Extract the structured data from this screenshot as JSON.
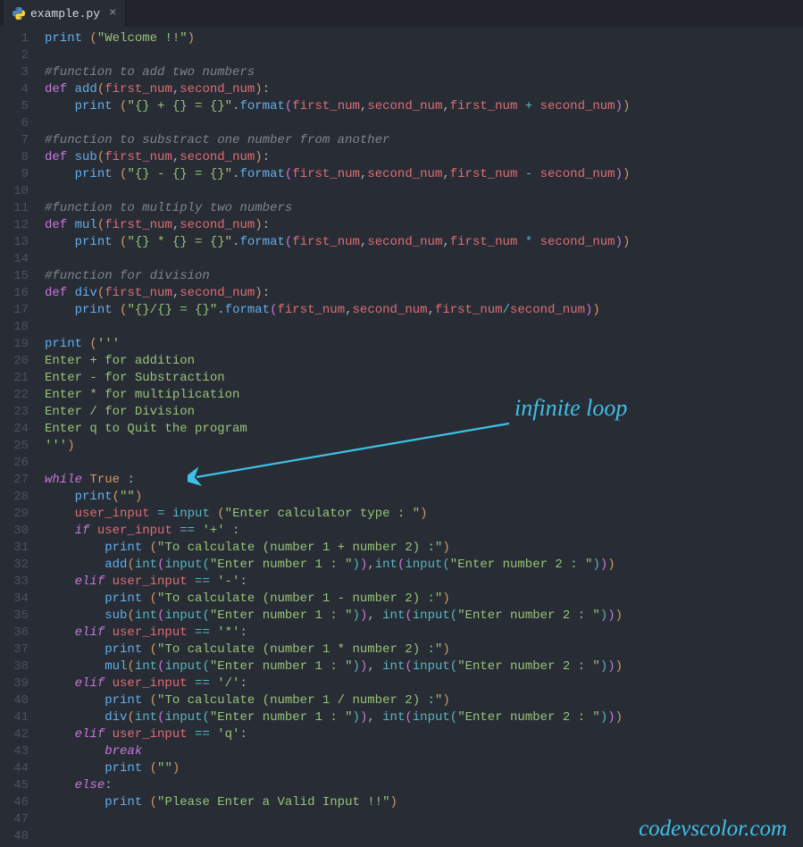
{
  "tab": {
    "filename": "example.py"
  },
  "annotation": {
    "label": "infinite loop"
  },
  "watermark": "codevscolor.com",
  "line_count": 48,
  "code_lines": [
    [
      [
        "fn",
        "print "
      ],
      [
        "br",
        "("
      ],
      [
        "str",
        "\"Welcome !!\""
      ],
      [
        "br",
        ")"
      ]
    ],
    [],
    [
      [
        "cmt",
        "#function to add two numbers"
      ]
    ],
    [
      [
        "kw",
        "def "
      ],
      [
        "fn",
        "add"
      ],
      [
        "br",
        "("
      ],
      [
        "id",
        "first_num"
      ],
      [
        "pun",
        ","
      ],
      [
        "id",
        "second_num"
      ],
      [
        "br",
        ")"
      ],
      [
        "pun",
        ":"
      ]
    ],
    [
      [
        "pun",
        "    "
      ],
      [
        "fn",
        "print "
      ],
      [
        "br",
        "("
      ],
      [
        "str",
        "\"{} + {} = {}\""
      ],
      [
        "pun",
        "."
      ],
      [
        "fn",
        "format"
      ],
      [
        "br2",
        "("
      ],
      [
        "id",
        "first_num"
      ],
      [
        "pun",
        ","
      ],
      [
        "id",
        "second_num"
      ],
      [
        "pun",
        ","
      ],
      [
        "id",
        "first_num "
      ],
      [
        "op",
        "+"
      ],
      [
        "id",
        " second_num"
      ],
      [
        "br2",
        ")"
      ],
      [
        "br",
        ")"
      ]
    ],
    [],
    [
      [
        "cmt",
        "#function to substract one number from another"
      ]
    ],
    [
      [
        "kw",
        "def "
      ],
      [
        "fn",
        "sub"
      ],
      [
        "br",
        "("
      ],
      [
        "id",
        "first_num"
      ],
      [
        "pun",
        ","
      ],
      [
        "id",
        "second_num"
      ],
      [
        "br",
        ")"
      ],
      [
        "pun",
        ":"
      ]
    ],
    [
      [
        "pun",
        "    "
      ],
      [
        "fn",
        "print "
      ],
      [
        "br",
        "("
      ],
      [
        "str",
        "\"{} - {} = {}\""
      ],
      [
        "pun",
        "."
      ],
      [
        "fn",
        "format"
      ],
      [
        "br2",
        "("
      ],
      [
        "id",
        "first_num"
      ],
      [
        "pun",
        ","
      ],
      [
        "id",
        "second_num"
      ],
      [
        "pun",
        ","
      ],
      [
        "id",
        "first_num "
      ],
      [
        "op",
        "-"
      ],
      [
        "id",
        " second_num"
      ],
      [
        "br2",
        ")"
      ],
      [
        "br",
        ")"
      ]
    ],
    [],
    [
      [
        "cmt",
        "#function to multiply two numbers"
      ]
    ],
    [
      [
        "kw",
        "def "
      ],
      [
        "fn",
        "mul"
      ],
      [
        "br",
        "("
      ],
      [
        "id",
        "first_num"
      ],
      [
        "pun",
        ","
      ],
      [
        "id",
        "second_num"
      ],
      [
        "br",
        ")"
      ],
      [
        "pun",
        ":"
      ]
    ],
    [
      [
        "pun",
        "    "
      ],
      [
        "fn",
        "print "
      ],
      [
        "br",
        "("
      ],
      [
        "str",
        "\"{} * {} = {}\""
      ],
      [
        "pun",
        "."
      ],
      [
        "fn",
        "format"
      ],
      [
        "br2",
        "("
      ],
      [
        "id",
        "first_num"
      ],
      [
        "pun",
        ","
      ],
      [
        "id",
        "second_num"
      ],
      [
        "pun",
        ","
      ],
      [
        "id",
        "first_num "
      ],
      [
        "op",
        "*"
      ],
      [
        "id",
        " second_num"
      ],
      [
        "br2",
        ")"
      ],
      [
        "br",
        ")"
      ]
    ],
    [],
    [
      [
        "cmt",
        "#function for division"
      ]
    ],
    [
      [
        "kw",
        "def "
      ],
      [
        "fn",
        "div"
      ],
      [
        "br",
        "("
      ],
      [
        "id",
        "first_num"
      ],
      [
        "pun",
        ","
      ],
      [
        "id",
        "second_num"
      ],
      [
        "br",
        ")"
      ],
      [
        "pun",
        ":"
      ]
    ],
    [
      [
        "pun",
        "    "
      ],
      [
        "fn",
        "print "
      ],
      [
        "br",
        "("
      ],
      [
        "str",
        "\"{}/{} = {}\""
      ],
      [
        "pun",
        "."
      ],
      [
        "fn",
        "format"
      ],
      [
        "br2",
        "("
      ],
      [
        "id",
        "first_num"
      ],
      [
        "pun",
        ","
      ],
      [
        "id",
        "second_num"
      ],
      [
        "pun",
        ","
      ],
      [
        "id",
        "first_num"
      ],
      [
        "op",
        "/"
      ],
      [
        "id",
        "second_num"
      ],
      [
        "br2",
        ")"
      ],
      [
        "br",
        ")"
      ]
    ],
    [],
    [
      [
        "fn",
        "print "
      ],
      [
        "br",
        "("
      ],
      [
        "str",
        "'''"
      ]
    ],
    [
      [
        "str",
        "Enter + for addition"
      ]
    ],
    [
      [
        "str",
        "Enter - for Substraction"
      ]
    ],
    [
      [
        "str",
        "Enter * for multiplication"
      ]
    ],
    [
      [
        "str",
        "Enter / for Division"
      ]
    ],
    [
      [
        "str",
        "Enter q to Quit the program"
      ]
    ],
    [
      [
        "str",
        "'''"
      ],
      [
        "br",
        ")"
      ]
    ],
    [],
    [
      [
        "kw2",
        "while "
      ],
      [
        "cnst",
        "True "
      ],
      [
        "pun",
        ":"
      ]
    ],
    [
      [
        "pun",
        "    "
      ],
      [
        "fn",
        "print"
      ],
      [
        "br",
        "("
      ],
      [
        "str",
        "\"\""
      ],
      [
        "br",
        ")"
      ]
    ],
    [
      [
        "pun",
        "    "
      ],
      [
        "id",
        "user_input "
      ],
      [
        "op",
        "="
      ],
      [
        "pun",
        " "
      ],
      [
        "bi",
        "input "
      ],
      [
        "br",
        "("
      ],
      [
        "str",
        "\"Enter calculator type : \""
      ],
      [
        "br",
        ")"
      ]
    ],
    [
      [
        "pun",
        "    "
      ],
      [
        "kw2",
        "if "
      ],
      [
        "id",
        "user_input "
      ],
      [
        "op",
        "=="
      ],
      [
        "str",
        " '+' "
      ],
      [
        "pun",
        ":"
      ]
    ],
    [
      [
        "pun",
        "        "
      ],
      [
        "fn",
        "print "
      ],
      [
        "br",
        "("
      ],
      [
        "str",
        "\"To calculate (number 1 + number 2) :\""
      ],
      [
        "br",
        ")"
      ]
    ],
    [
      [
        "pun",
        "        "
      ],
      [
        "fn",
        "add"
      ],
      [
        "br",
        "("
      ],
      [
        "bi",
        "int"
      ],
      [
        "br2",
        "("
      ],
      [
        "bi",
        "input"
      ],
      [
        "br3",
        "("
      ],
      [
        "str",
        "\"Enter number 1 : \""
      ],
      [
        "br3",
        ")"
      ],
      [
        "br2",
        ")"
      ],
      [
        "pun",
        ","
      ],
      [
        "bi",
        "int"
      ],
      [
        "br2",
        "("
      ],
      [
        "bi",
        "input"
      ],
      [
        "br3",
        "("
      ],
      [
        "str",
        "\"Enter number 2 : \""
      ],
      [
        "br3",
        ")"
      ],
      [
        "br2",
        ")"
      ],
      [
        "br",
        ")"
      ]
    ],
    [
      [
        "pun",
        "    "
      ],
      [
        "kw2",
        "elif "
      ],
      [
        "id",
        "user_input "
      ],
      [
        "op",
        "=="
      ],
      [
        "str",
        " '-'"
      ],
      [
        "pun",
        ":"
      ]
    ],
    [
      [
        "pun",
        "        "
      ],
      [
        "fn",
        "print "
      ],
      [
        "br",
        "("
      ],
      [
        "str",
        "\"To calculate (number 1 - number 2) :\""
      ],
      [
        "br",
        ")"
      ]
    ],
    [
      [
        "pun",
        "        "
      ],
      [
        "fn",
        "sub"
      ],
      [
        "br",
        "("
      ],
      [
        "bi",
        "int"
      ],
      [
        "br2",
        "("
      ],
      [
        "bi",
        "input"
      ],
      [
        "br3",
        "("
      ],
      [
        "str",
        "\"Enter number 1 : \""
      ],
      [
        "br3",
        ")"
      ],
      [
        "br2",
        ")"
      ],
      [
        "pun",
        ", "
      ],
      [
        "bi",
        "int"
      ],
      [
        "br2",
        "("
      ],
      [
        "bi",
        "input"
      ],
      [
        "br3",
        "("
      ],
      [
        "str",
        "\"Enter number 2 : \""
      ],
      [
        "br3",
        ")"
      ],
      [
        "br2",
        ")"
      ],
      [
        "br",
        ")"
      ]
    ],
    [
      [
        "pun",
        "    "
      ],
      [
        "kw2",
        "elif "
      ],
      [
        "id",
        "user_input "
      ],
      [
        "op",
        "=="
      ],
      [
        "str",
        " '*'"
      ],
      [
        "pun",
        ":"
      ]
    ],
    [
      [
        "pun",
        "        "
      ],
      [
        "fn",
        "print "
      ],
      [
        "br",
        "("
      ],
      [
        "str",
        "\"To calculate (number 1 * number 2) :\""
      ],
      [
        "br",
        ")"
      ]
    ],
    [
      [
        "pun",
        "        "
      ],
      [
        "fn",
        "mul"
      ],
      [
        "br",
        "("
      ],
      [
        "bi",
        "int"
      ],
      [
        "br2",
        "("
      ],
      [
        "bi",
        "input"
      ],
      [
        "br3",
        "("
      ],
      [
        "str",
        "\"Enter number 1 : \""
      ],
      [
        "br3",
        ")"
      ],
      [
        "br2",
        ")"
      ],
      [
        "pun",
        ", "
      ],
      [
        "bi",
        "int"
      ],
      [
        "br2",
        "("
      ],
      [
        "bi",
        "input"
      ],
      [
        "br3",
        "("
      ],
      [
        "str",
        "\"Enter number 2 : \""
      ],
      [
        "br3",
        ")"
      ],
      [
        "br2",
        ")"
      ],
      [
        "br",
        ")"
      ]
    ],
    [
      [
        "pun",
        "    "
      ],
      [
        "kw2",
        "elif "
      ],
      [
        "id",
        "user_input "
      ],
      [
        "op",
        "=="
      ],
      [
        "str",
        " '/'"
      ],
      [
        "pun",
        ":"
      ]
    ],
    [
      [
        "pun",
        "        "
      ],
      [
        "fn",
        "print "
      ],
      [
        "br",
        "("
      ],
      [
        "str",
        "\"To calculate (number 1 / number 2) :\""
      ],
      [
        "br",
        ")"
      ]
    ],
    [
      [
        "pun",
        "        "
      ],
      [
        "fn",
        "div"
      ],
      [
        "br",
        "("
      ],
      [
        "bi",
        "int"
      ],
      [
        "br2",
        "("
      ],
      [
        "bi",
        "input"
      ],
      [
        "br3",
        "("
      ],
      [
        "str",
        "\"Enter number 1 : \""
      ],
      [
        "br3",
        ")"
      ],
      [
        "br2",
        ")"
      ],
      [
        "pun",
        ", "
      ],
      [
        "bi",
        "int"
      ],
      [
        "br2",
        "("
      ],
      [
        "bi",
        "input"
      ],
      [
        "br3",
        "("
      ],
      [
        "str",
        "\"Enter number 2 : \""
      ],
      [
        "br3",
        ")"
      ],
      [
        "br2",
        ")"
      ],
      [
        "br",
        ")"
      ]
    ],
    [
      [
        "pun",
        "    "
      ],
      [
        "kw2",
        "elif "
      ],
      [
        "id",
        "user_input "
      ],
      [
        "op",
        "=="
      ],
      [
        "str",
        " 'q'"
      ],
      [
        "pun",
        ":"
      ]
    ],
    [
      [
        "pun",
        "        "
      ],
      [
        "kw2",
        "break"
      ]
    ],
    [
      [
        "pun",
        "        "
      ],
      [
        "fn",
        "print "
      ],
      [
        "br",
        "("
      ],
      [
        "str",
        "\"\""
      ],
      [
        "br",
        ")"
      ]
    ],
    [
      [
        "pun",
        "    "
      ],
      [
        "kw2",
        "else"
      ],
      [
        "pun",
        ":"
      ]
    ],
    [
      [
        "pun",
        "        "
      ],
      [
        "fn",
        "print "
      ],
      [
        "br",
        "("
      ],
      [
        "str",
        "\"Please Enter a Valid Input !!\""
      ],
      [
        "br",
        ")"
      ]
    ],
    [],
    []
  ]
}
